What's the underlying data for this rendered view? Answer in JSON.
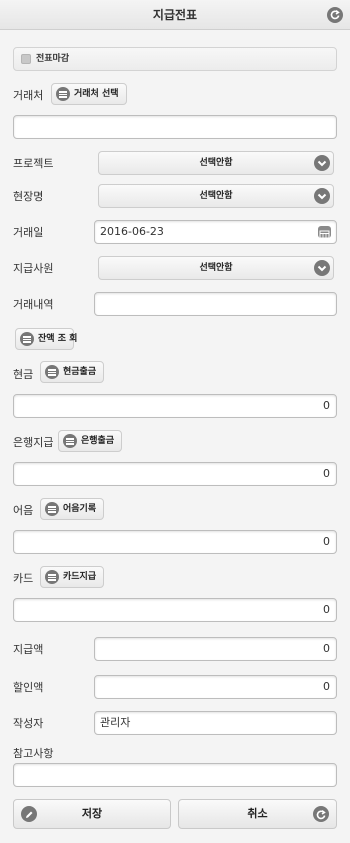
{
  "header": {
    "title": "지급전표",
    "back_icon": "back-arrow-icon"
  },
  "closing_check": {
    "label": "전표마감",
    "checked": false
  },
  "partner": {
    "label": "거래처",
    "button_label": "거래처 선택",
    "value": ""
  },
  "project": {
    "label": "프로젝트",
    "selected": "선택안함"
  },
  "site": {
    "label": "현장명",
    "selected": "선택안함"
  },
  "trade_date": {
    "label": "거래일",
    "value": "2016-06-23"
  },
  "employee": {
    "label": "지급사원",
    "selected": "선택안함"
  },
  "trade_detail": {
    "label": "거래내역",
    "value": ""
  },
  "balance_button": {
    "label": "잔액 조 회"
  },
  "cash": {
    "label": "현금",
    "button_label": "현금출금",
    "value": "0"
  },
  "bank": {
    "label": "은행지급",
    "button_label": "은행출금",
    "value": "0"
  },
  "bill": {
    "label": "어음",
    "button_label": "어음기록",
    "value": "0"
  },
  "card": {
    "label": "카드",
    "button_label": "카드지급",
    "value": "0"
  },
  "payment_amount": {
    "label": "지급액",
    "value": "0"
  },
  "discount_amount": {
    "label": "할인액",
    "value": "0"
  },
  "writer": {
    "label": "작성자",
    "value": "관리자"
  },
  "notes": {
    "label": "참고사항",
    "value": ""
  },
  "actions": {
    "save_label": "저장",
    "cancel_label": "취소"
  },
  "colors": {
    "icon_bg": "#777777",
    "header_bg": "#ececec",
    "border": "#bdbdbd"
  }
}
